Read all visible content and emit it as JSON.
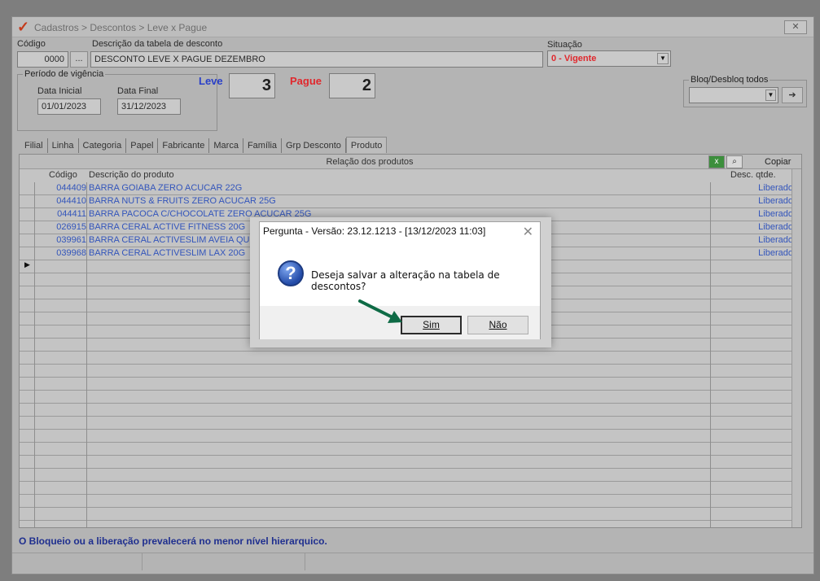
{
  "window": {
    "title": "Cadastros > Descontos > Leve x Pague",
    "close_label": "✕"
  },
  "form": {
    "codigo_label": "Código",
    "codigo_value": "0000",
    "lookup_label": "...",
    "descricao_label": "Descrição da tabela de desconto",
    "descricao_value": "DESCONTO LEVE X PAGUE DEZEMBRO",
    "situacao_label": "Situação",
    "situacao_value": "0 - Vigente",
    "periodo_label": "Período de vigência",
    "data_inicial_label": "Data Inicial",
    "data_inicial_value": "01/01/2023",
    "data_final_label": "Data Final",
    "data_final_value": "31/12/2023",
    "leve_label": "Leve",
    "leve_value": "3",
    "pague_label": "Pague",
    "pague_value": "2",
    "bloq_label": "Bloq/Desbloq todos",
    "bloq_value": ""
  },
  "tabs": [
    "Filial",
    "Linha",
    "Categoria",
    "Papel",
    "Fabricante",
    "Marca",
    "Família",
    "Grp Desconto",
    "Produto"
  ],
  "active_tab": "Produto",
  "grid": {
    "title": "Relação dos produtos",
    "copiar_label": "Copiar",
    "columns": {
      "codigo": "Código",
      "descricao": "Descrição do produto",
      "desc_qtde": "Desc. qtde."
    },
    "rows": [
      {
        "codigo": "044409",
        "descricao": "BARRA GOIABA ZERO ACUCAR 22G",
        "status": "Liberado"
      },
      {
        "codigo": "044410",
        "descricao": "BARRA NUTS & FRUITS ZERO ACUCAR 25G",
        "status": "Liberado"
      },
      {
        "codigo": "044411",
        "descricao": "BARRA PACOCA C/CHOCOLATE ZERO ACUCAR 25G",
        "status": "Liberado"
      },
      {
        "codigo": "026915",
        "descricao": "BARRA CERAL ACTIVE FITNESS 20G",
        "status": "Liberado"
      },
      {
        "codigo": "039961",
        "descricao": "BARRA CERAL ACTIVESLIM AVEIA QUINOA",
        "status": "Liberado"
      },
      {
        "codigo": "039968",
        "descricao": "BARRA CERAL ACTIVESLIM LAX 20G",
        "status": "Liberado"
      }
    ]
  },
  "status_message": "O Bloqueio ou a liberação prevalecerá no menor nível hierarquico.",
  "dialog": {
    "title": "Pergunta - Versão: 23.12.1213 - [13/12/2023 11:03]",
    "message": "Deseja salvar a alteração na tabela de descontos?",
    "yes_label": "Sim",
    "no_label": "Não",
    "icon": "question-icon"
  },
  "colors": {
    "accent_red": "#e0282d",
    "accent_blue": "#2a40c8",
    "link_blue": "#3355bb",
    "arrow_green": "#0f6b46"
  }
}
